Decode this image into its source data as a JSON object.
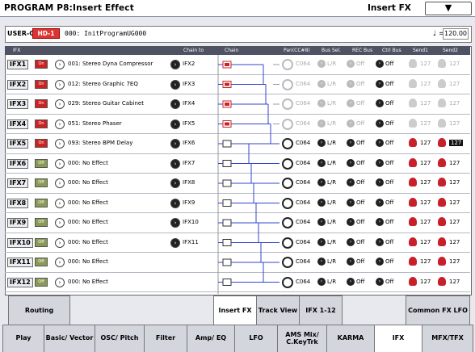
{
  "window": {
    "title": "PROGRAM P8:Insert Effect",
    "page": "Insert FX",
    "menu_icon": "▼"
  },
  "program": {
    "bank": "USER-G",
    "bank_box": "HD-1",
    "name": "000: InitProgramUG000",
    "tempo_label": "♩ =",
    "tempo": "120.00"
  },
  "headers": {
    "ifx": "IFX",
    "chain_to": "Chain to",
    "chain": "Chain",
    "pan": "Pan(CC#8)",
    "bus_sel": "Bus Sel.",
    "rec_bus": "REC Bus",
    "ctrl_bus": "Ctrl Bus",
    "send1": "Send1",
    "send2": "Send2"
  },
  "rows": [
    {
      "label": "IFX1",
      "on": "On",
      "fx": "001: Stereo Dyna Compressor",
      "chain_to": "IFX2",
      "pan": "C064",
      "bus": "L/R",
      "rec": "Off",
      "ctrl": "Off",
      "s1": "127",
      "s2": "127",
      "dim": true
    },
    {
      "label": "IFX2",
      "on": "On",
      "fx": "012: Stereo Graphic 7EQ",
      "chain_to": "IFX3",
      "pan": "C064",
      "bus": "L/R",
      "rec": "Off",
      "ctrl": "Off",
      "s1": "127",
      "s2": "127",
      "dim": true
    },
    {
      "label": "IFX3",
      "on": "On",
      "fx": "029: Stereo Guitar Cabinet",
      "chain_to": "IFX4",
      "pan": "C064",
      "bus": "L/R",
      "rec": "Off",
      "ctrl": "Off",
      "s1": "127",
      "s2": "127",
      "dim": true
    },
    {
      "label": "IFX4",
      "on": "On",
      "fx": "051: Stereo Phaser",
      "chain_to": "IFX5",
      "pan": "C064",
      "bus": "L/R",
      "rec": "Off",
      "ctrl": "Off",
      "s1": "127",
      "s2": "127",
      "dim": true
    },
    {
      "label": "IFX5",
      "on": "On",
      "fx": "093: Stereo BPM Delay",
      "chain_to": "IFX6",
      "pan": "C064",
      "bus": "L/R",
      "rec": "Off",
      "ctrl": "Off",
      "s1": "127",
      "s2": "127",
      "dim": false,
      "sel": true
    },
    {
      "label": "IFX6",
      "on": "Off",
      "fx": "000: No Effect",
      "chain_to": "IFX7",
      "pan": "C064",
      "bus": "L/R",
      "rec": "Off",
      "ctrl": "Off",
      "s1": "127",
      "s2": "127",
      "dim": false
    },
    {
      "label": "IFX7",
      "on": "Off",
      "fx": "000: No Effect",
      "chain_to": "IFX8",
      "pan": "C064",
      "bus": "L/R",
      "rec": "Off",
      "ctrl": "Off",
      "s1": "127",
      "s2": "127",
      "dim": false
    },
    {
      "label": "IFX8",
      "on": "Off",
      "fx": "000: No Effect",
      "chain_to": "IFX9",
      "pan": "C064",
      "bus": "L/R",
      "rec": "Off",
      "ctrl": "Off",
      "s1": "127",
      "s2": "127",
      "dim": false
    },
    {
      "label": "IFX9",
      "on": "Off",
      "fx": "000: No Effect",
      "chain_to": "IFX10",
      "pan": "C064",
      "bus": "L/R",
      "rec": "Off",
      "ctrl": "Off",
      "s1": "127",
      "s2": "127",
      "dim": false
    },
    {
      "label": "IFX10",
      "on": "Off",
      "fx": "000: No Effect",
      "chain_to": "IFX11",
      "pan": "C064",
      "bus": "L/R",
      "rec": "Off",
      "ctrl": "Off",
      "s1": "127",
      "s2": "127",
      "dim": false
    },
    {
      "label": "IFX11",
      "on": "Off",
      "fx": "000: No Effect",
      "chain_to": "",
      "pan": "C064",
      "bus": "L/R",
      "rec": "Off",
      "ctrl": "Off",
      "s1": "127",
      "s2": "127",
      "dim": false
    },
    {
      "label": "IFX12",
      "on": "Off",
      "fx": "000: No Effect",
      "chain_to": "",
      "pan": "C064",
      "bus": "L/R",
      "rec": "Off",
      "ctrl": "Off",
      "s1": "127",
      "s2": "127",
      "dim": false
    }
  ],
  "subtabs": {
    "routing": "Routing",
    "insert_fx": "Insert FX",
    "track_view": "Track View",
    "ifx_1_12": "IFX 1-12",
    "common_fx_lfo": "Common FX LFO"
  },
  "tabs": {
    "play": "Play",
    "basic_vector": "Basic/ Vector",
    "osc_pitch": "OSC/ Pitch",
    "filter": "Filter",
    "amp_eq": "Amp/ EQ",
    "lfo": "LFO",
    "ams_mix": "AMS Mix/ C.KeyTrk",
    "karma": "KARMA",
    "ifx": "IFX",
    "mfx_tfx": "MFX/TFX"
  },
  "colors": {
    "accent_red": "#c8202a",
    "header_bg": "#4e5262",
    "on_red": "#cc2222",
    "off_green": "#8a9a55",
    "chain_blue": "#3344cc"
  }
}
